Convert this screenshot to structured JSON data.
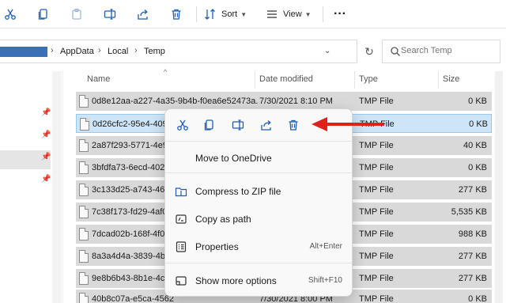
{
  "toolbar": {
    "sort_label": "Sort",
    "view_label": "View",
    "more_label": "···",
    "icons": [
      "cut-icon",
      "copy-icon",
      "paste-icon",
      "rename-icon",
      "share-icon",
      "delete-icon"
    ]
  },
  "address": {
    "crumbs": [
      "AppData",
      "Local",
      "Temp"
    ]
  },
  "search": {
    "placeholder": "Search Temp"
  },
  "columns": {
    "name": "Name",
    "date": "Date modified",
    "type": "Type",
    "size": "Size"
  },
  "files": [
    {
      "name": "0d8e12aa-a227-4a35-9b4b-f0ea6e52473a...",
      "date": "7/30/2021 8:10 PM",
      "type": "TMP File",
      "size": "0 KB"
    },
    {
      "name": "0d26cfc2-95e4-4096",
      "date": "",
      "type": "TMP File",
      "size": "0 KB"
    },
    {
      "name": "2a87f293-5771-4e98",
      "date": "",
      "type": "TMP File",
      "size": "40 KB"
    },
    {
      "name": "3bfdfa73-6ecd-402b",
      "date": "",
      "type": "TMP File",
      "size": "0 KB"
    },
    {
      "name": "3c133d25-a743-4670",
      "date": "",
      "type": "TMP File",
      "size": "277 KB"
    },
    {
      "name": "7c38f173-fd29-4af0-",
      "date": "",
      "type": "TMP File",
      "size": "5,535 KB"
    },
    {
      "name": "7dcad02b-168f-4f01",
      "date": "",
      "type": "TMP File",
      "size": "988 KB"
    },
    {
      "name": "8a3a4d4a-3839-4be2",
      "date": "",
      "type": "TMP File",
      "size": "277 KB"
    },
    {
      "name": "9e8b6b43-8b1e-4c8b",
      "date": "",
      "type": "TMP File",
      "size": "277 KB"
    },
    {
      "name": "40b8c07a-e5ca-4562",
      "date": "7/30/2021 8:00 PM",
      "type": "TMP File",
      "size": "0 KB"
    }
  ],
  "context_menu": {
    "icon_row": [
      "cut-icon",
      "copy-icon",
      "rename-icon",
      "share-icon",
      "delete-icon"
    ],
    "items": [
      {
        "label": "Move to OneDrive",
        "shortcut": ""
      },
      {
        "label": "Compress to ZIP file",
        "shortcut": ""
      },
      {
        "label": "Copy as path",
        "shortcut": ""
      },
      {
        "label": "Properties",
        "shortcut": "Alt+Enter"
      },
      {
        "label": "Show more options",
        "shortcut": "Shift+F10"
      }
    ]
  },
  "colors": {
    "accent": "#1d5fb8",
    "arrow": "#e0201b",
    "selected_row": "#cde5f7",
    "row_bg": "#d9d9d9"
  }
}
